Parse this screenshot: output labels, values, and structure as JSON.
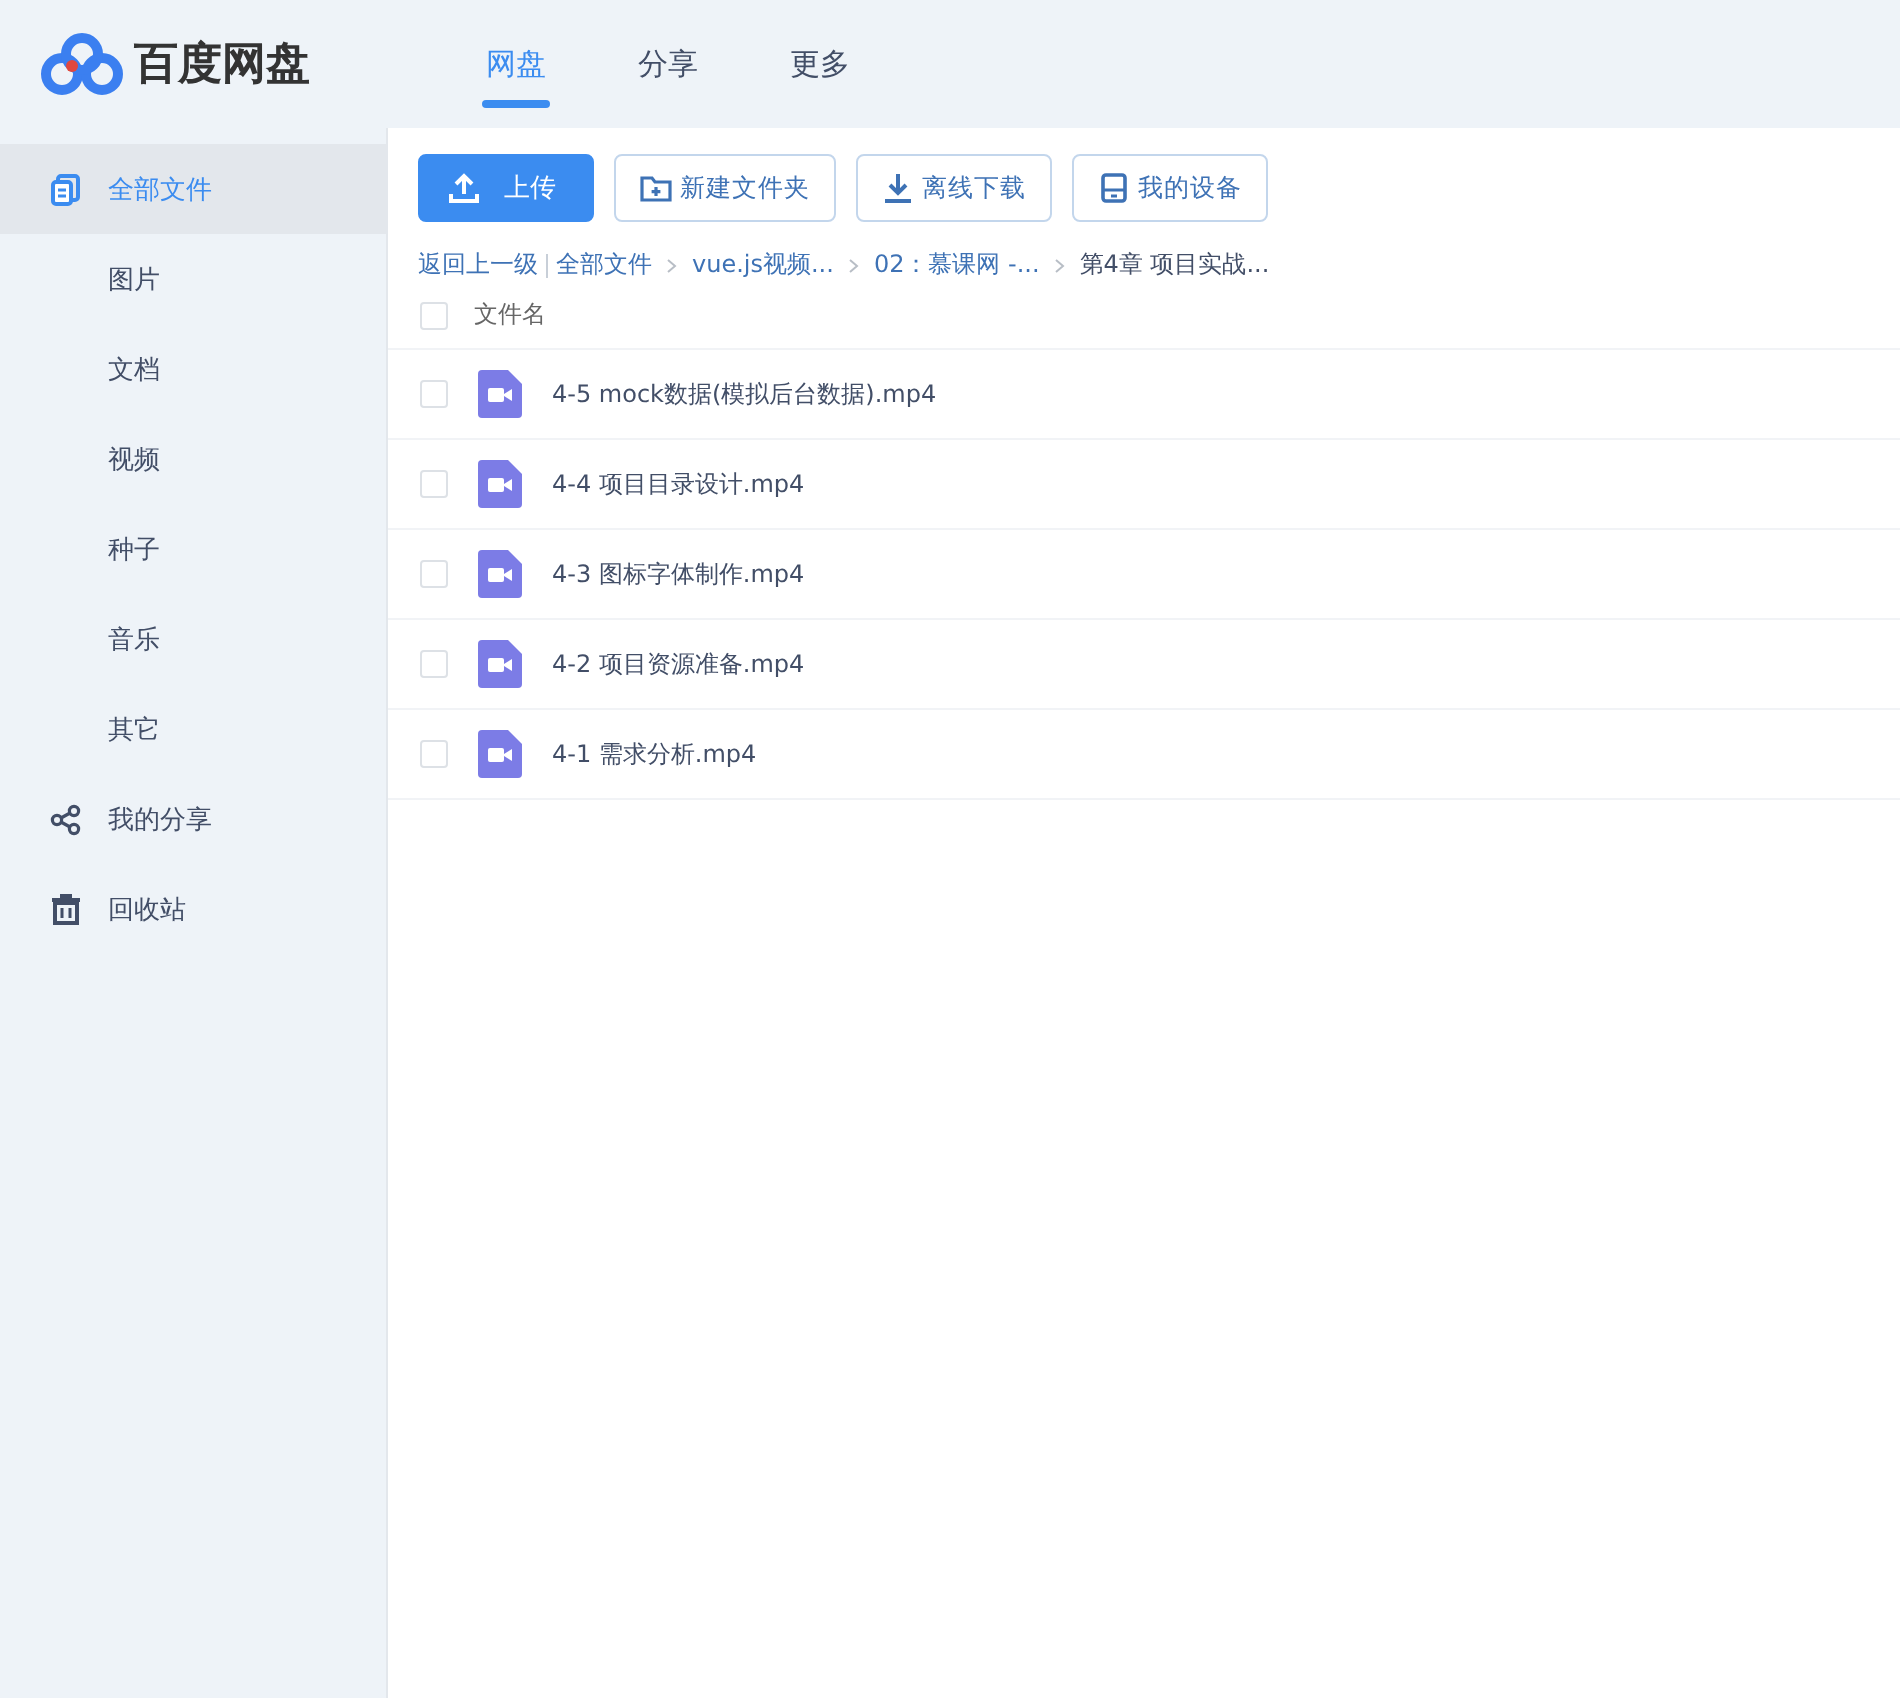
{
  "header": {
    "logo_text": "百度网盘",
    "tabs": [
      {
        "label": "网盘",
        "selected": true
      },
      {
        "label": "分享",
        "selected": false
      },
      {
        "label": "更多",
        "selected": false
      }
    ]
  },
  "sidebar": {
    "items": [
      {
        "label": "全部文件",
        "kind": "main",
        "selected": true
      },
      {
        "label": "图片",
        "kind": "sub",
        "selected": false
      },
      {
        "label": "文档",
        "kind": "sub",
        "selected": false
      },
      {
        "label": "视频",
        "kind": "sub",
        "selected": false
      },
      {
        "label": "种子",
        "kind": "sub",
        "selected": false
      },
      {
        "label": "音乐",
        "kind": "sub",
        "selected": false
      },
      {
        "label": "其它",
        "kind": "sub",
        "selected": false
      },
      {
        "label": "我的分享",
        "kind": "main",
        "selected": false
      },
      {
        "label": "回收站",
        "kind": "main",
        "selected": false
      }
    ]
  },
  "toolbar": [
    {
      "label": "上传",
      "kind": "primary"
    },
    {
      "label": "新建文件夹",
      "kind": "default"
    },
    {
      "label": "离线下载",
      "kind": "default"
    },
    {
      "label": "我的设备",
      "kind": "default"
    }
  ],
  "breadcrumb": {
    "back": "返回上一级",
    "crumbs": [
      {
        "label": "全部文件",
        "current": false
      },
      {
        "label": "vue.js视频...",
        "current": false
      },
      {
        "label": "02：慕课网 -...",
        "current": false
      },
      {
        "label": "第4章 项目实战...",
        "current": true
      }
    ]
  },
  "table": {
    "header": {
      "label": "文件名",
      "checked": false
    },
    "rows": [
      {
        "name": "4-5 mock数据(模拟后台数据).mp4",
        "checked": false
      },
      {
        "name": "4-4 项目目录设计.mp4",
        "checked": false
      },
      {
        "name": "4-3 图标字体制作.mp4",
        "checked": false
      },
      {
        "name": "4-2 项目资源准备.mp4",
        "checked": false
      },
      {
        "name": "4-1 需求分析.mp4",
        "checked": false
      }
    ]
  }
}
